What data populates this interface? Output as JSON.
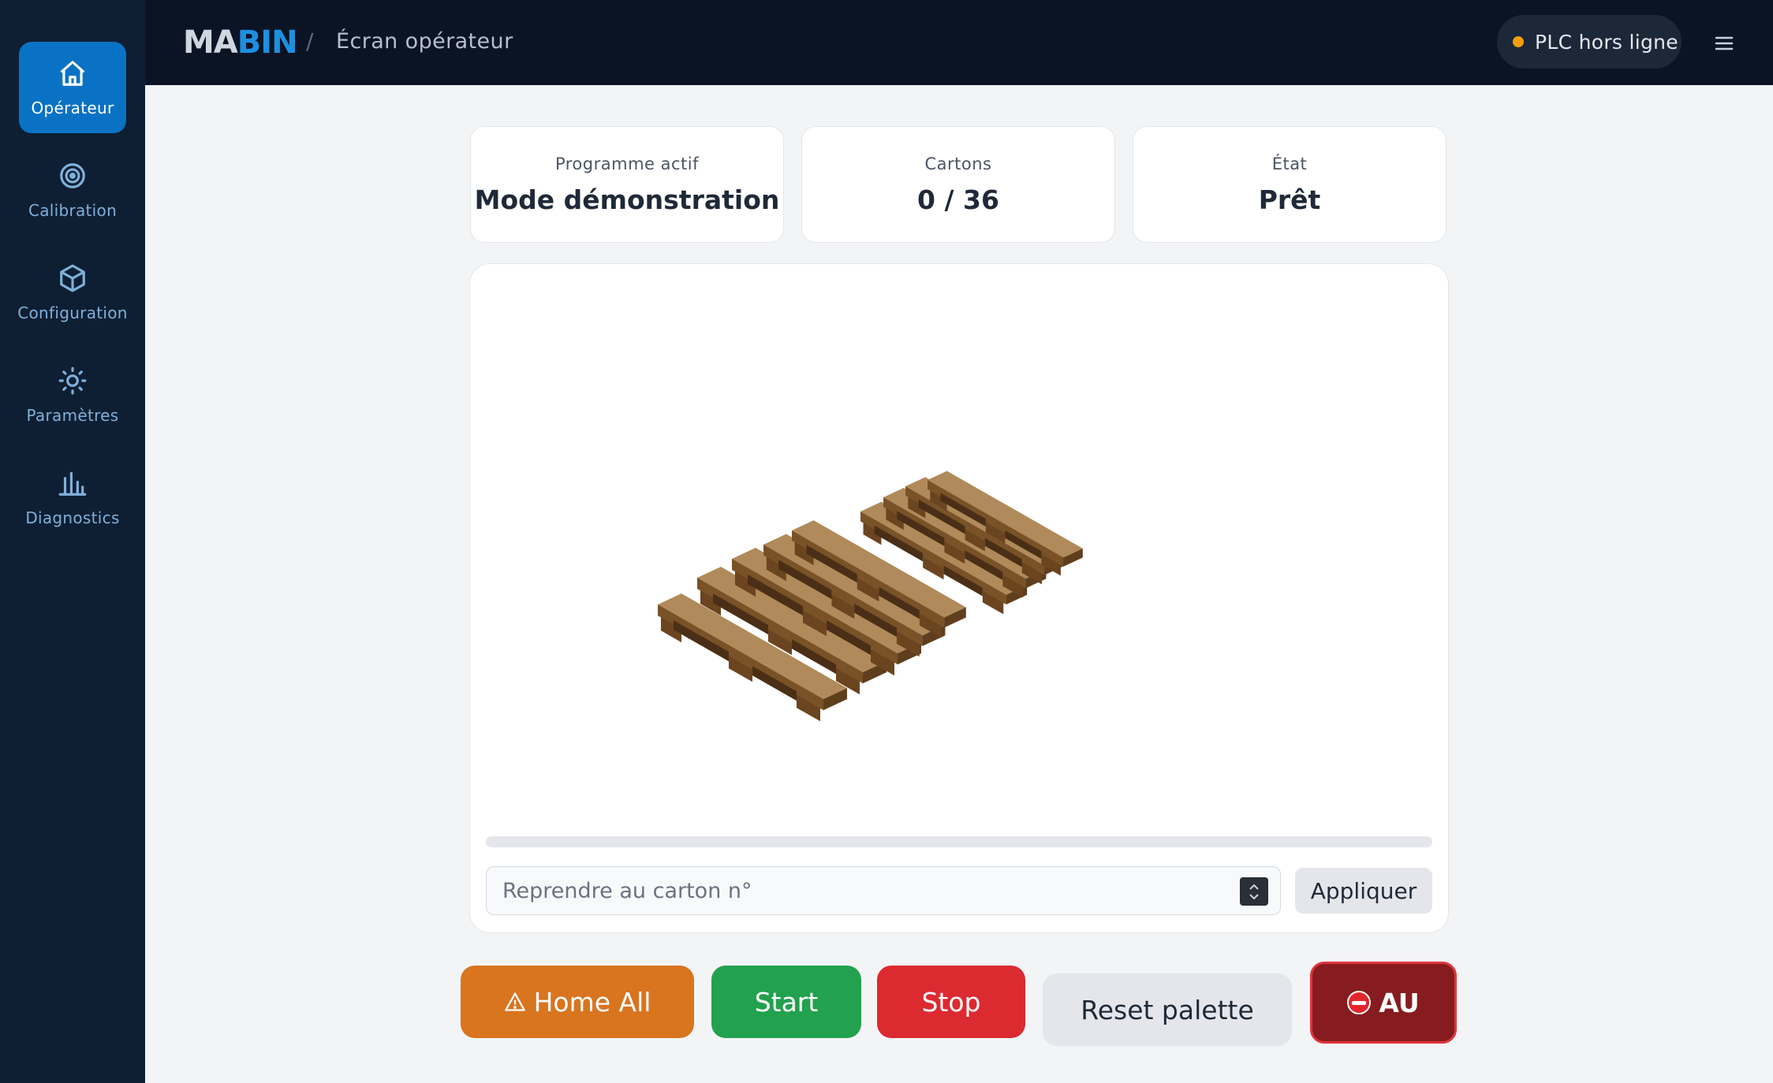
{
  "brand": {
    "logo_part1": "MA",
    "logo_part2": "BIN"
  },
  "header": {
    "separator": "/",
    "breadcrumb": "Écran opérateur"
  },
  "status": {
    "text": "PLC hors ligne",
    "dot_color": "#f59e0b"
  },
  "sidebar": {
    "items": [
      {
        "label": "Opérateur",
        "icon": "home-icon",
        "active": true
      },
      {
        "label": "Calibration",
        "icon": "target-icon",
        "active": false
      },
      {
        "label": "Configuration",
        "icon": "cube-icon",
        "active": false
      },
      {
        "label": "Paramètres",
        "icon": "sun-icon",
        "active": false
      },
      {
        "label": "Diagnostics",
        "icon": "bar-chart-icon",
        "active": false
      }
    ]
  },
  "stats": {
    "program": {
      "label": "Programme actif",
      "value": "Mode démonstration"
    },
    "cartons": {
      "label": "Cartons",
      "value": "0 / 36"
    },
    "state": {
      "label": "État",
      "value": "Prêt"
    }
  },
  "viewer": {
    "progress_fraction": 0
  },
  "resume": {
    "placeholder": "Reprendre au carton n°",
    "apply_label": "Appliquer"
  },
  "actions": {
    "home_all": "Home All",
    "start": "Start",
    "stop": "Stop",
    "reset": "Reset palette",
    "emergency": "AU"
  },
  "colors": {
    "accent": "#0a72c4",
    "home": "#d9741f",
    "start": "#22a14e",
    "stop": "#dc2a31",
    "emergency": "#861c1f"
  }
}
